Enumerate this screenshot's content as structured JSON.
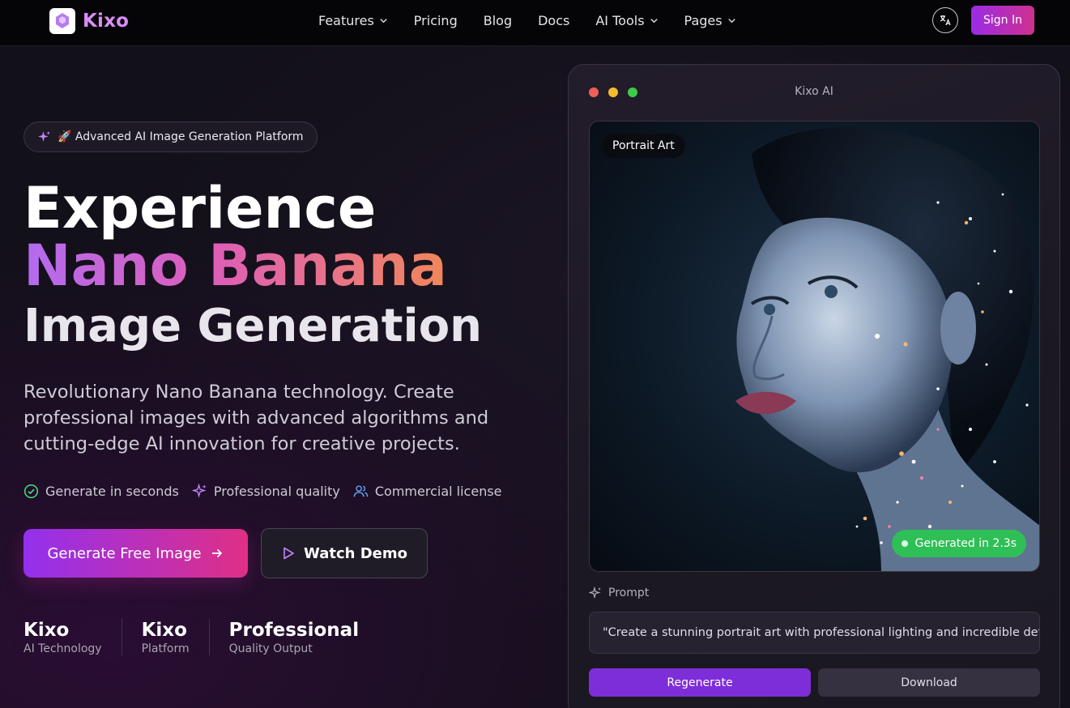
{
  "nav": {
    "brand": "Kixo",
    "links": [
      {
        "label": "Features",
        "dropdown": true
      },
      {
        "label": "Pricing",
        "dropdown": false
      },
      {
        "label": "Blog",
        "dropdown": false
      },
      {
        "label": "Docs",
        "dropdown": false
      },
      {
        "label": "AI Tools",
        "dropdown": true
      },
      {
        "label": "Pages",
        "dropdown": true
      }
    ],
    "language_icon": "translate-icon",
    "signin_label": "Sign In"
  },
  "hero": {
    "badge": "🚀 Advanced AI Image Generation Platform",
    "title_line1": "Experience",
    "title_line2": "Nano Banana",
    "title_line3": "Image Generation",
    "subtitle": "Revolutionary Nano Banana technology. Create professional images with advanced algorithms and cutting-edge AI innovation for creative projects.",
    "features": [
      {
        "icon": "check-circle-icon",
        "label": "Generate in seconds",
        "color": "#4ade80"
      },
      {
        "icon": "sparkles-icon",
        "label": "Professional quality",
        "color": "#c084fc"
      },
      {
        "icon": "users-icon",
        "label": "Commercial license",
        "color": "#60a5fa"
      }
    ],
    "cta_primary": "Generate Free Image",
    "cta_secondary": "Watch Demo",
    "stats": [
      {
        "value": "Kixo",
        "label": "AI Technology"
      },
      {
        "value": "Kixo",
        "label": "Platform"
      },
      {
        "value": "Professional",
        "label": "Quality Output"
      }
    ]
  },
  "preview": {
    "window_title": "Kixo AI",
    "image_tag": "Portrait Art",
    "generated_label": "Generated in 2.3s",
    "prompt_label": "Prompt",
    "prompt_text": "\"Create a stunning portrait art with professional lighting and incredible detail\"",
    "regenerate_label": "Regenerate",
    "download_label": "Download"
  },
  "colors": {
    "accent_purple": "#9330ee",
    "accent_pink": "#e02f86",
    "success": "#2fbf57"
  }
}
